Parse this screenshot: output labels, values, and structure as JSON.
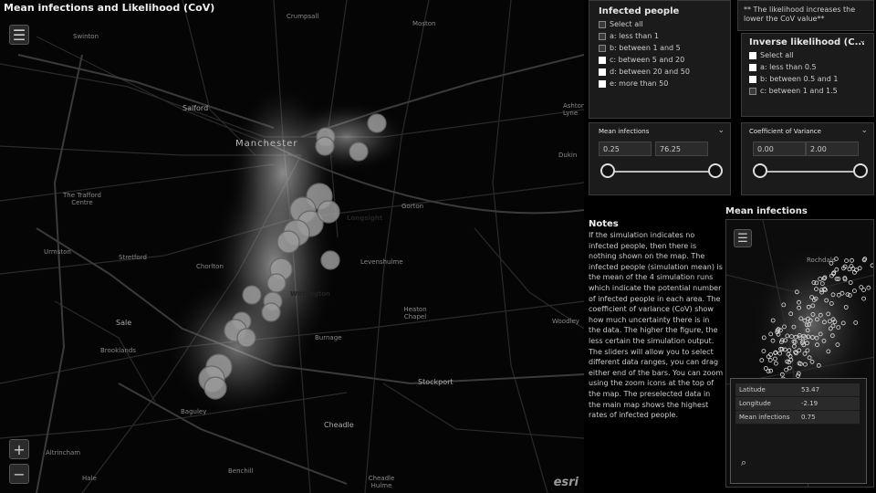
{
  "map": {
    "title": "Mean infections and Likelihood (CoV)",
    "labels": {
      "swinton": "Swinton",
      "crumpsall": "Crumpsall",
      "moston": "Moston",
      "salford": "Salford",
      "manchester": "Manchester",
      "the_trafford_centre": "The Trafford Centre",
      "gorton": "Gorton",
      "urmston": "Urmston",
      "stretford": "Stretford",
      "chorlton": "Chorlton",
      "levenshulme": "Levenshulme",
      "sale": "Sale",
      "brooklands": "Brooklands",
      "burnage": "Burnage",
      "heaton_chapel": "Heaton Chapel",
      "stockport": "Stockport",
      "cheadle": "Cheadle",
      "altrincham": "Altrincham",
      "benchill": "Benchill",
      "cheadle_hulme": "Cheadle Hulme",
      "baguley": "Baguley",
      "hale": "Hale",
      "longsight": "Longsight",
      "withington": "Withington",
      "woodley": "Woodley",
      "dukinfield": "Dukin",
      "ashton": "Ashton-u\nLyne"
    },
    "attribution": "esri",
    "icons": {
      "menu": "menu-icon",
      "zoom_in": "plus-icon",
      "zoom_out": "minus-icon"
    }
  },
  "infected_filter": {
    "title": "Infected people",
    "options": [
      {
        "label": "Select all",
        "state": "dark"
      },
      {
        "label": "a: less than 1",
        "state": "dark"
      },
      {
        "label": "b: between 1 and 5",
        "state": "dark"
      },
      {
        "label": "c: between 5 and 20",
        "state": "on"
      },
      {
        "label": "d: between 20 and 50",
        "state": "on"
      },
      {
        "label": "e: more than 50",
        "state": "on"
      }
    ]
  },
  "likelihood_note": "** The likelihood increases the lower the CoV value**",
  "likelihood_filter": {
    "title": "Inverse likelihood (C...",
    "options": [
      {
        "label": "Select all",
        "state": "on"
      },
      {
        "label": "a: less than 0.5",
        "state": "on"
      },
      {
        "label": "b: between 0.5 and 1",
        "state": "on"
      },
      {
        "label": "c: between 1 and 1.5",
        "state": "dark"
      }
    ]
  },
  "mean_slider": {
    "title": "Mean infections",
    "min": "0.25",
    "max": "76.25"
  },
  "cov_slider": {
    "title": "Coefficient of Variance",
    "min": "0.00",
    "max": "2.00"
  },
  "notes": {
    "title": "Notes",
    "body": "If the simulation indicates no infected people, then there is nothing shown on the map. The infected people (simulation mean) is the mean of the 4 simulation runs which indicate the potential number of infected people in each area. The coefficient of variance (CoV) show how much uncertainty there is in the data. The higher the figure, the less certain the simulation output. The sliders will allow you to select different data ranges, you can drag either end of the bars. You can zoom using the zoom icons at the top of the map. The preselected data in the main map shows the highest rates of infected people."
  },
  "mini_map": {
    "title": "Mean infections",
    "label_rochdale": "Rochdale"
  },
  "popup": {
    "rows": [
      {
        "key": "Latitude",
        "value": "53.47"
      },
      {
        "key": "Longitude",
        "value": "-2.19"
      },
      {
        "key": "Mean infections",
        "value": "0.75"
      }
    ],
    "icon": "zoom-icon"
  },
  "colors": {
    "background": "#000000",
    "panel": "#1b1b1b",
    "glow": "#ffffff",
    "marker_fill": "#9a9a9a"
  }
}
